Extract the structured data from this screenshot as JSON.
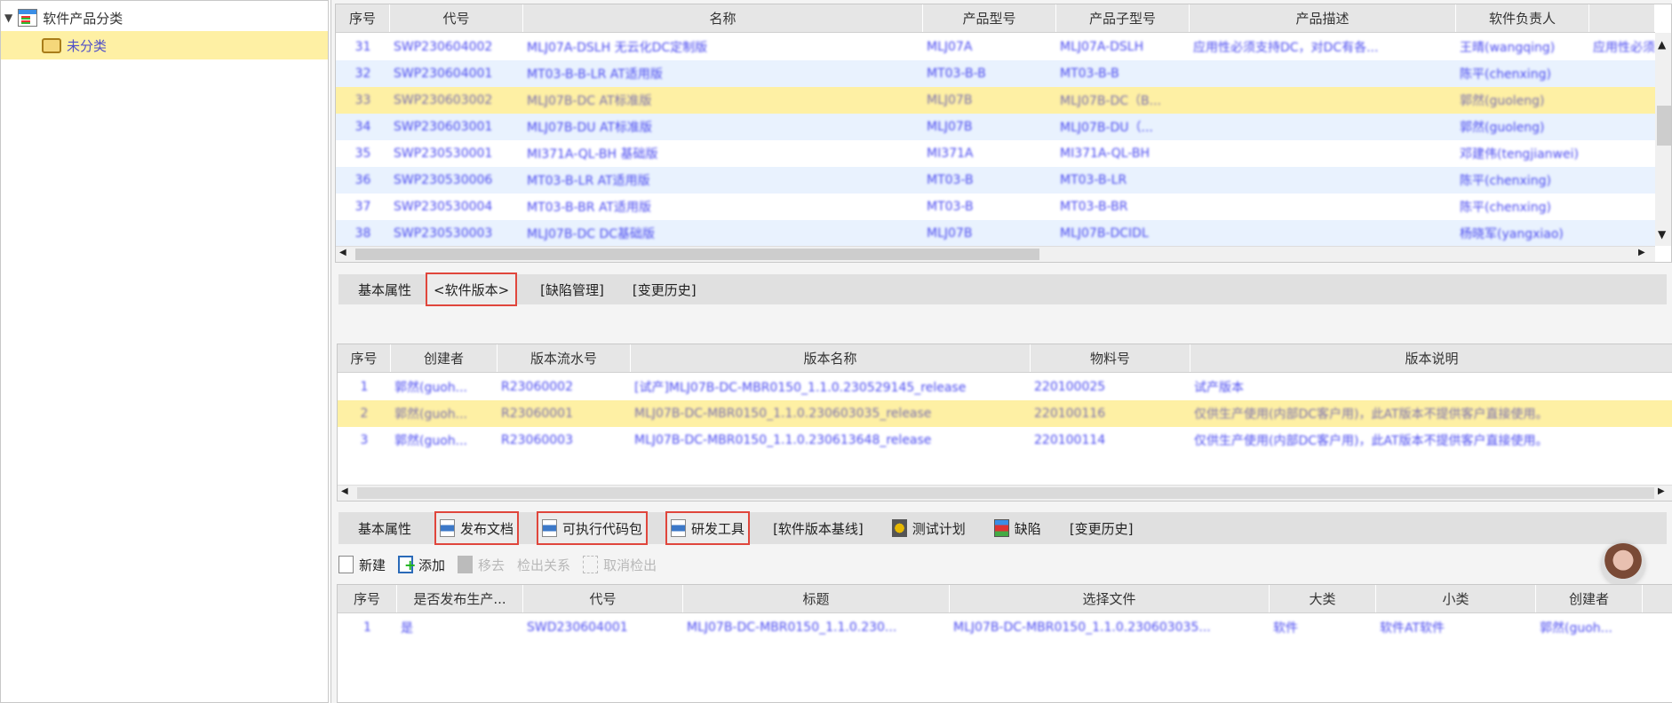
{
  "tree": {
    "root": "软件产品分类",
    "child": "未分类"
  },
  "products": {
    "columns": [
      "序号",
      "代号",
      "名称",
      "产品型号",
      "产品子型号",
      "产品描述",
      "软件负责人",
      ""
    ],
    "rows": [
      [
        "31",
        "SWP230604002",
        "MLJ07A-DSLH 无云化DC定制版",
        "MLJ07A",
        "MLJ07A-DSLH",
        "应用性必须支持DC，对DC有各...",
        "王晴(wangqing)",
        "应用性必须"
      ],
      [
        "32",
        "SWP230604001",
        "MT03-B-B-LR AT适用版",
        "MT03-B-B",
        "MT03-B-B",
        "",
        "陈平(chenxing)",
        ""
      ],
      [
        "33",
        "SWP230603002",
        "MLJ07B-DC AT标准版",
        "MLJ07B",
        "MLJ07B-DC（B...",
        "",
        "郭然(guoleng)",
        ""
      ],
      [
        "34",
        "SWP230603001",
        "MLJ07B-DU AT标准版",
        "MLJ07B",
        "MLJ07B-DU（...",
        "",
        "郭然(guoleng)",
        ""
      ],
      [
        "35",
        "SWP230530001",
        "MI371A-QL-BH 基础版",
        "MI371A",
        "MI371A-QL-BH",
        "",
        "邓建伟(tengjianwei)",
        ""
      ],
      [
        "36",
        "SWP230530006",
        "MT03-B-LR AT适用版",
        "MT03-B",
        "MT03-B-LR",
        "",
        "陈平(chenxing)",
        ""
      ],
      [
        "37",
        "SWP230530004",
        "MT03-B-BR AT适用版",
        "MT03-B",
        "MT03-B-BR",
        "",
        "陈平(chenxing)",
        ""
      ],
      [
        "38",
        "SWP230530003",
        "MLJ07B-DC DC基础版",
        "MLJ07B",
        "MLJ07B-DCIDL",
        "",
        "杨晓军(yangxiao)",
        ""
      ]
    ]
  },
  "tabs1": [
    "基本属性",
    "<软件版本>",
    "[缺陷管理]",
    "[变更历史]"
  ],
  "versions": {
    "columns": [
      "序号",
      "创建者",
      "版本流水号",
      "版本名称",
      "物料号",
      "版本说明"
    ],
    "rows": [
      [
        "1",
        "郭然(guoh...",
        "R23060002",
        "[试产]MLJ07B-DC-MBR0150_1.1.0.230529145_release",
        "220100025",
        "试产版本"
      ],
      [
        "2",
        "郭然(guoh...",
        "R23060001",
        "MLJ07B-DC-MBR0150_1.1.0.230603035_release",
        "220100116",
        "仅供生产使用(内部DC客户用)，此AT版本不提供客户直接使用。"
      ],
      [
        "3",
        "郭然(guoh...",
        "R23060003",
        "MLJ07B-DC-MBR0150_1.1.0.230613648_release",
        "220100114",
        "仅供生产使用(内部DC客户用)，此AT版本不提供客户直接使用。"
      ]
    ]
  },
  "tabs2": [
    {
      "label": "基本属性",
      "icon": ""
    },
    {
      "label": "发布文档",
      "icon": "document-icon"
    },
    {
      "label": "可执行代码包",
      "icon": "document-icon"
    },
    {
      "label": "研发工具",
      "icon": "document-icon"
    },
    {
      "label": "[软件版本基线]",
      "icon": ""
    },
    {
      "label": "测试计划",
      "icon": "test-plan-icon"
    },
    {
      "label": "缺陷",
      "icon": "defect-icon"
    },
    {
      "label": "[变更历史]",
      "icon": ""
    }
  ],
  "toolbar": {
    "new": "新建",
    "add": "添加",
    "remove": "移去",
    "checkout_rel": "检出关系",
    "cancel_checkout": "取消检出"
  },
  "docs": {
    "columns": [
      "序号",
      "是否发布生产...",
      "代号",
      "标题",
      "选择文件",
      "大类",
      "小类",
      "创建者",
      ""
    ],
    "rows": [
      [
        "1",
        "是",
        "SWD230604001",
        "MLJ07B-DC-MBR0150_1.1.0.230...",
        "MLJ07B-DC-MBR0150_1.1.0.230603035...",
        "软件",
        "软件AT软件",
        "郭然(guoh...",
        ""
      ]
    ]
  },
  "colors": {
    "accent_box": "#e0463c",
    "selected_row": "#fef0a4",
    "alt_row": "#e9f2fe",
    "link_text": "#4a4af0"
  }
}
